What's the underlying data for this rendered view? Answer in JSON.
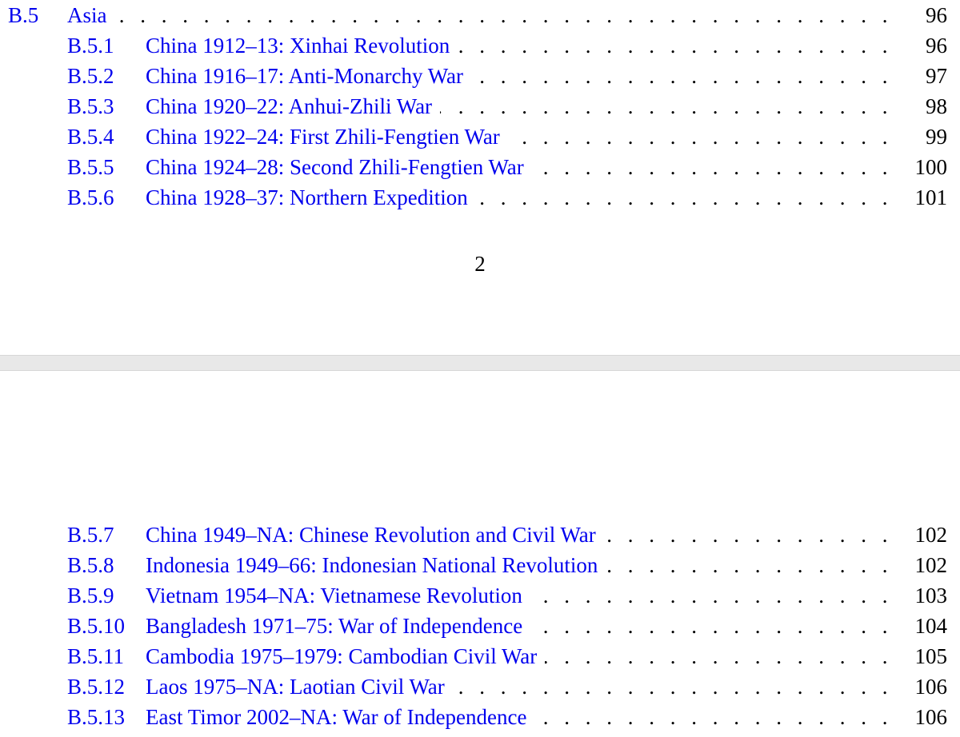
{
  "top_page": {
    "entries": [
      {
        "num": "B.5",
        "title": "Asia",
        "page": "96",
        "level": 1
      },
      {
        "num": "B.5.1",
        "title": "China 1912–13: Xinhai Revolution",
        "page": "96",
        "level": 2
      },
      {
        "num": "B.5.2",
        "title": "China 1916–17: Anti-Monarchy War",
        "page": "97",
        "level": 2
      },
      {
        "num": "B.5.3",
        "title": "China 1920–22: Anhui-Zhili War",
        "page": "98",
        "level": 2
      },
      {
        "num": "B.5.4",
        "title": "China 1922–24: First Zhili-Fengtien War",
        "page": "99",
        "level": 2
      },
      {
        "num": "B.5.5",
        "title": "China 1924–28: Second Zhili-Fengtien War",
        "page": "100",
        "level": 2
      },
      {
        "num": "B.5.6",
        "title": "China 1928–37: Northern Expedition",
        "page": "101",
        "level": 2
      }
    ],
    "page_number": "2"
  },
  "bottom_page": {
    "entries": [
      {
        "num": "B.5.7",
        "title": "China 1949–NA: Chinese Revolution and Civil War",
        "page": "102",
        "level": 2
      },
      {
        "num": "B.5.8",
        "title": "Indonesia 1949–66: Indonesian National Revolution",
        "page": "102",
        "level": 2
      },
      {
        "num": "B.5.9",
        "title": "Vietnam 1954–NA: Vietnamese Revolution",
        "page": "103",
        "level": 2
      },
      {
        "num": "B.5.10",
        "title": "Bangladesh 1971–75: War of Independence",
        "page": "104",
        "level": 2
      },
      {
        "num": "B.5.11",
        "title": "Cambodia 1975–1979: Cambodian Civil War",
        "page": "105",
        "level": 2
      },
      {
        "num": "B.5.12",
        "title": "Laos 1975–NA: Laotian Civil War",
        "page": "106",
        "level": 2
      },
      {
        "num": "B.5.13",
        "title": "East Timor 2002–NA: War of Independence",
        "page": "106",
        "level": 2
      }
    ]
  }
}
